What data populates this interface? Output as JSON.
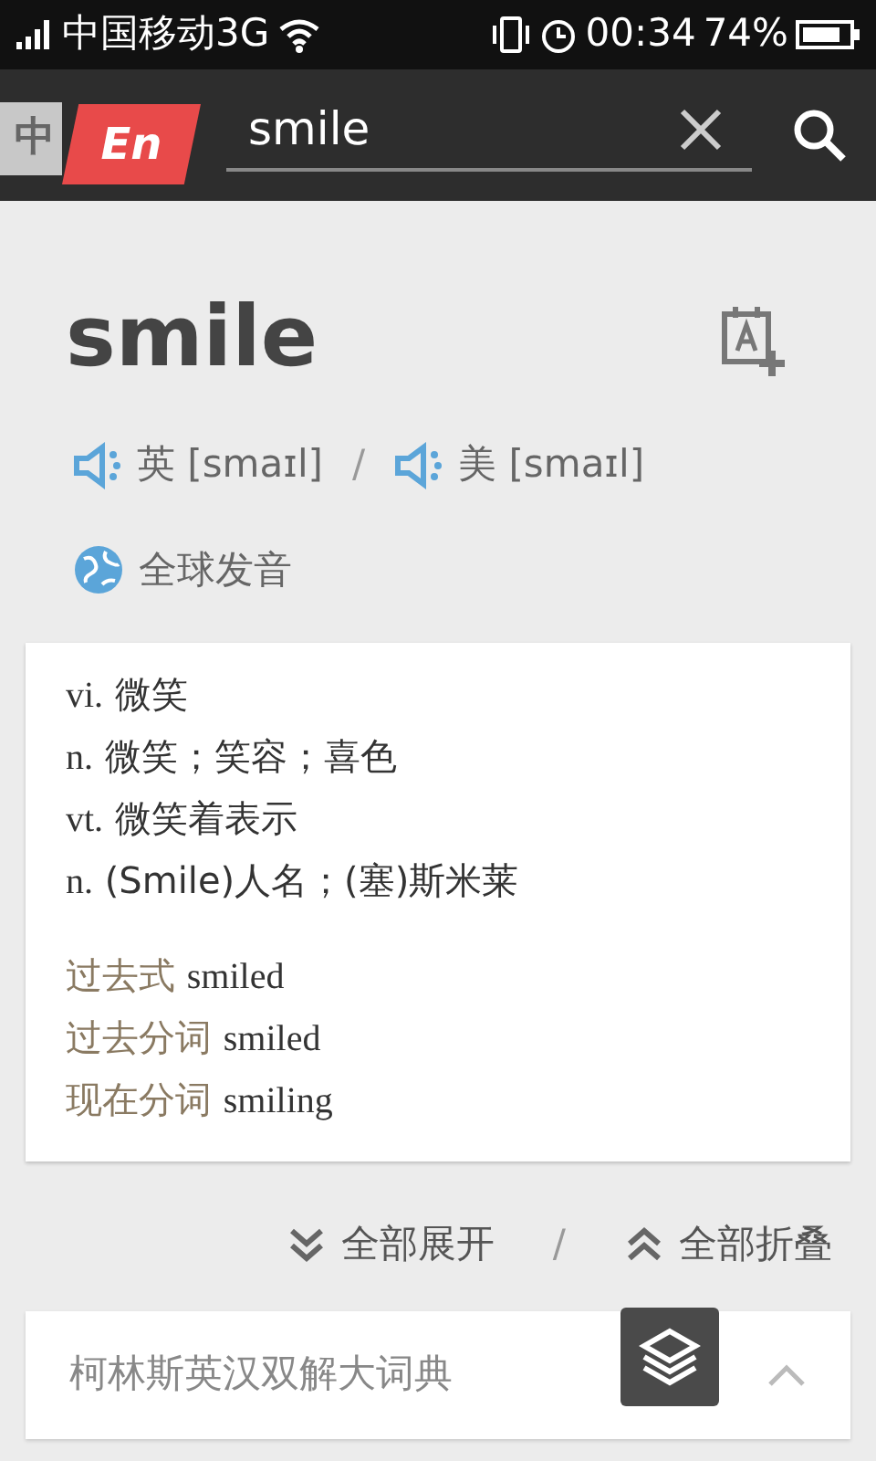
{
  "status_bar": {
    "carrier": "中国移动3G",
    "time": "00:34",
    "battery": "74%"
  },
  "toolbar": {
    "lang_inactive": "中",
    "lang_active": "En",
    "query": "smile"
  },
  "word": {
    "headword": "smile",
    "pronunciations": [
      {
        "region": "英",
        "phonetic": "[smaɪl]"
      },
      {
        "region": "美",
        "phonetic": "[smaɪl]"
      }
    ],
    "separator": "/",
    "global_label": "全球发音"
  },
  "definitions": [
    {
      "pos": "vi.",
      "meaning": "微笑"
    },
    {
      "pos": "n.",
      "meaning": "微笑；笑容；喜色"
    },
    {
      "pos": "vt.",
      "meaning": "微笑着表示"
    },
    {
      "pos": "n.",
      "meaning": "(Smile)人名；(塞)斯米莱"
    }
  ],
  "forms": [
    {
      "label": "过去式",
      "value": "smiled"
    },
    {
      "label": "过去分词",
      "value": "smiled"
    },
    {
      "label": "现在分词",
      "value": "smiling"
    }
  ],
  "actions": {
    "expand": "全部展开",
    "separator": "/",
    "collapse": "全部折叠"
  },
  "sections": [
    {
      "title": "柯林斯英汉双解大词典",
      "expanded": true
    }
  ]
}
